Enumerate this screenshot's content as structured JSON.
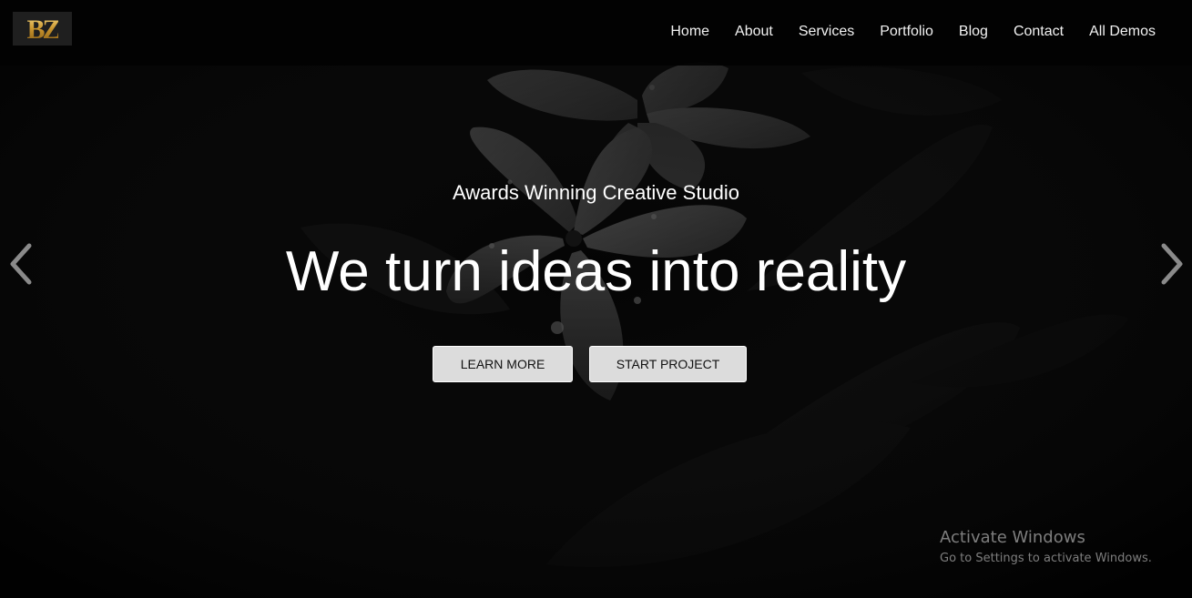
{
  "brand": {
    "logo_text": "BZ",
    "logo_color": "#c9952e"
  },
  "nav": {
    "items": [
      {
        "label": "Home"
      },
      {
        "label": "About"
      },
      {
        "label": "Services"
      },
      {
        "label": "Portfolio"
      },
      {
        "label": "Blog"
      },
      {
        "label": "Contact"
      },
      {
        "label": "All Demos"
      }
    ]
  },
  "hero": {
    "subtitle": "Awards Winning Creative Studio",
    "title": "We turn ideas into reality",
    "buttons": {
      "learn_more": "LEARN MORE",
      "start_project": "START PROJECT"
    },
    "background_description_icon": "flower-photo"
  },
  "carousel": {
    "prev_icon": "chevron-left-icon",
    "next_icon": "chevron-right-icon"
  },
  "watermark": {
    "title": "Activate Windows",
    "subtitle": "Go to Settings to activate Windows."
  },
  "colors": {
    "background": "#070707",
    "text": "#ffffff",
    "button_bg": "#dcdcdc"
  }
}
